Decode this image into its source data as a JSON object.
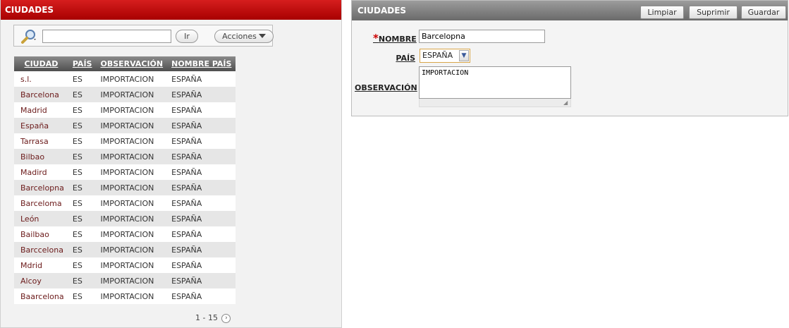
{
  "list_region": {
    "title": "CIUDADES",
    "search": {
      "value": "",
      "placeholder": ""
    },
    "go_label": "Ir",
    "actions_label": "Acciones",
    "columns": [
      "CIUDAD",
      "PAÍS",
      "OBSERVACIÓN",
      "NOMBRE PAÍS"
    ],
    "rows": [
      {
        "ciudad": "s.l.",
        "pais": "ES",
        "observacion": "IMPORTACION",
        "nombre_pais": "ESPAÑA"
      },
      {
        "ciudad": "Barcelona",
        "pais": "ES",
        "observacion": "IMPORTACION",
        "nombre_pais": "ESPAÑA"
      },
      {
        "ciudad": "Madrid",
        "pais": "ES",
        "observacion": "IMPORTACION",
        "nombre_pais": "ESPAÑA"
      },
      {
        "ciudad": "España",
        "pais": "ES",
        "observacion": "IMPORTACION",
        "nombre_pais": "ESPAÑA"
      },
      {
        "ciudad": "Tarrasa",
        "pais": "ES",
        "observacion": "IMPORTACION",
        "nombre_pais": "ESPAÑA"
      },
      {
        "ciudad": "Bilbao",
        "pais": "ES",
        "observacion": "IMPORTACION",
        "nombre_pais": "ESPAÑA"
      },
      {
        "ciudad": "Madird",
        "pais": "ES",
        "observacion": "IMPORTACION",
        "nombre_pais": "ESPAÑA"
      },
      {
        "ciudad": "Barcelopna",
        "pais": "ES",
        "observacion": "IMPORTACION",
        "nombre_pais": "ESPAÑA"
      },
      {
        "ciudad": "Barceloma",
        "pais": "ES",
        "observacion": "IMPORTACION",
        "nombre_pais": "ESPAÑA"
      },
      {
        "ciudad": "León",
        "pais": "ES",
        "observacion": "IMPORTACION",
        "nombre_pais": "ESPAÑA"
      },
      {
        "ciudad": "Bailbao",
        "pais": "ES",
        "observacion": "IMPORTACION",
        "nombre_pais": "ESPAÑA"
      },
      {
        "ciudad": "Barccelona",
        "pais": "ES",
        "observacion": "IMPORTACION",
        "nombre_pais": "ESPAÑA"
      },
      {
        "ciudad": "Mdrid",
        "pais": "ES",
        "observacion": "IMPORTACION",
        "nombre_pais": "ESPAÑA"
      },
      {
        "ciudad": "Alcoy",
        "pais": "ES",
        "observacion": "IMPORTACION",
        "nombre_pais": "ESPAÑA"
      },
      {
        "ciudad": "Baarcelona",
        "pais": "ES",
        "observacion": "IMPORTACION",
        "nombre_pais": "ESPAÑA"
      }
    ],
    "pagination": "1 - 15",
    "icons": {
      "search": "search-magnifier-icon",
      "actions": "triangle-down-icon",
      "next": "next-page-icon"
    }
  },
  "form_region": {
    "title": "CIUDADES",
    "buttons": {
      "clear": "Limpiar",
      "delete": "Suprimir",
      "save": "Guardar"
    },
    "fields": {
      "nombre": {
        "label": "NOMBRE",
        "required_mark": "*",
        "value": "Barcelopna"
      },
      "pais": {
        "label": "PAÍS",
        "selected": "ESPAÑA"
      },
      "observacion": {
        "label": "OBSERVACIÓN",
        "value": "IMPORTACION"
      }
    }
  },
  "colors": {
    "list_header": "#bf0f0f",
    "form_header": "#858585",
    "table_header": "#666666",
    "city_link": "#6b1a1a",
    "required": "#cc0000"
  }
}
